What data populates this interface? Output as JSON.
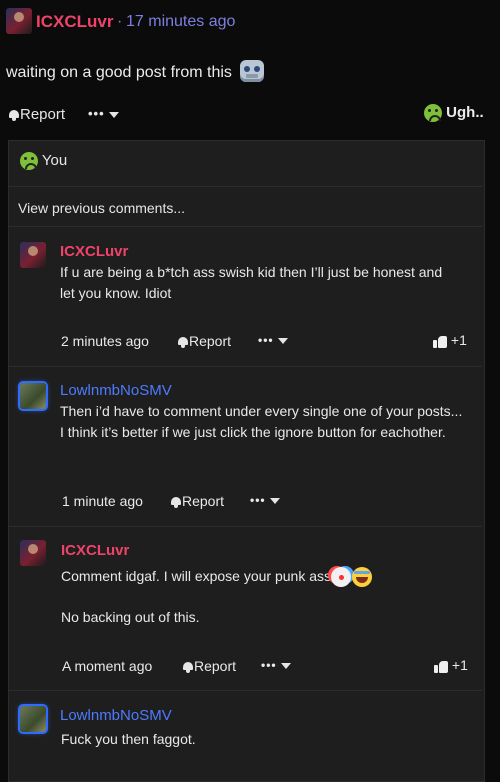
{
  "post": {
    "author": "ICXCLuvr",
    "time_sep": "·",
    "time": "17 minutes ago",
    "body": "waiting on a good post from this",
    "emoji_icon": "robot-face-icon",
    "report_label": "Report",
    "more_label": "•••",
    "reaction_label": "Ugh.."
  },
  "panel": {
    "reaction_summary": "You",
    "view_previous": "View previous comments..."
  },
  "comments": [
    {
      "author": "ICXCLuvr",
      "text": "If u are being a b*tch ass swish kid then I’ll just be honest and let you know. Idiot",
      "time": "2 minutes ago",
      "report_label": "Report",
      "more_label": "•••",
      "likes": "+1"
    },
    {
      "author": "LowlnmbNoSMV",
      "text": "Then i’d have to comment under every single one of your posts... I think it’s better if we just click the ignore button for eachother.",
      "time": "1 minute ago",
      "report_label": "Report",
      "more_label": "•••"
    },
    {
      "author": "ICXCLuvr",
      "text": "Comment idgaf. I will expose your punk ass",
      "text2": "No backing out of this.",
      "time": "A moment ago",
      "report_label": "Report",
      "more_label": "•••",
      "likes": "+1"
    },
    {
      "author": "LowlnmbNoSMV",
      "text": "Fuck you then faggot."
    }
  ],
  "colors": {
    "name_red": "#f0436a",
    "name_blue": "#4d7bff",
    "time_purple": "#7d7fe0",
    "background": "#0b0b0b",
    "panel": "#1e1e1e"
  }
}
